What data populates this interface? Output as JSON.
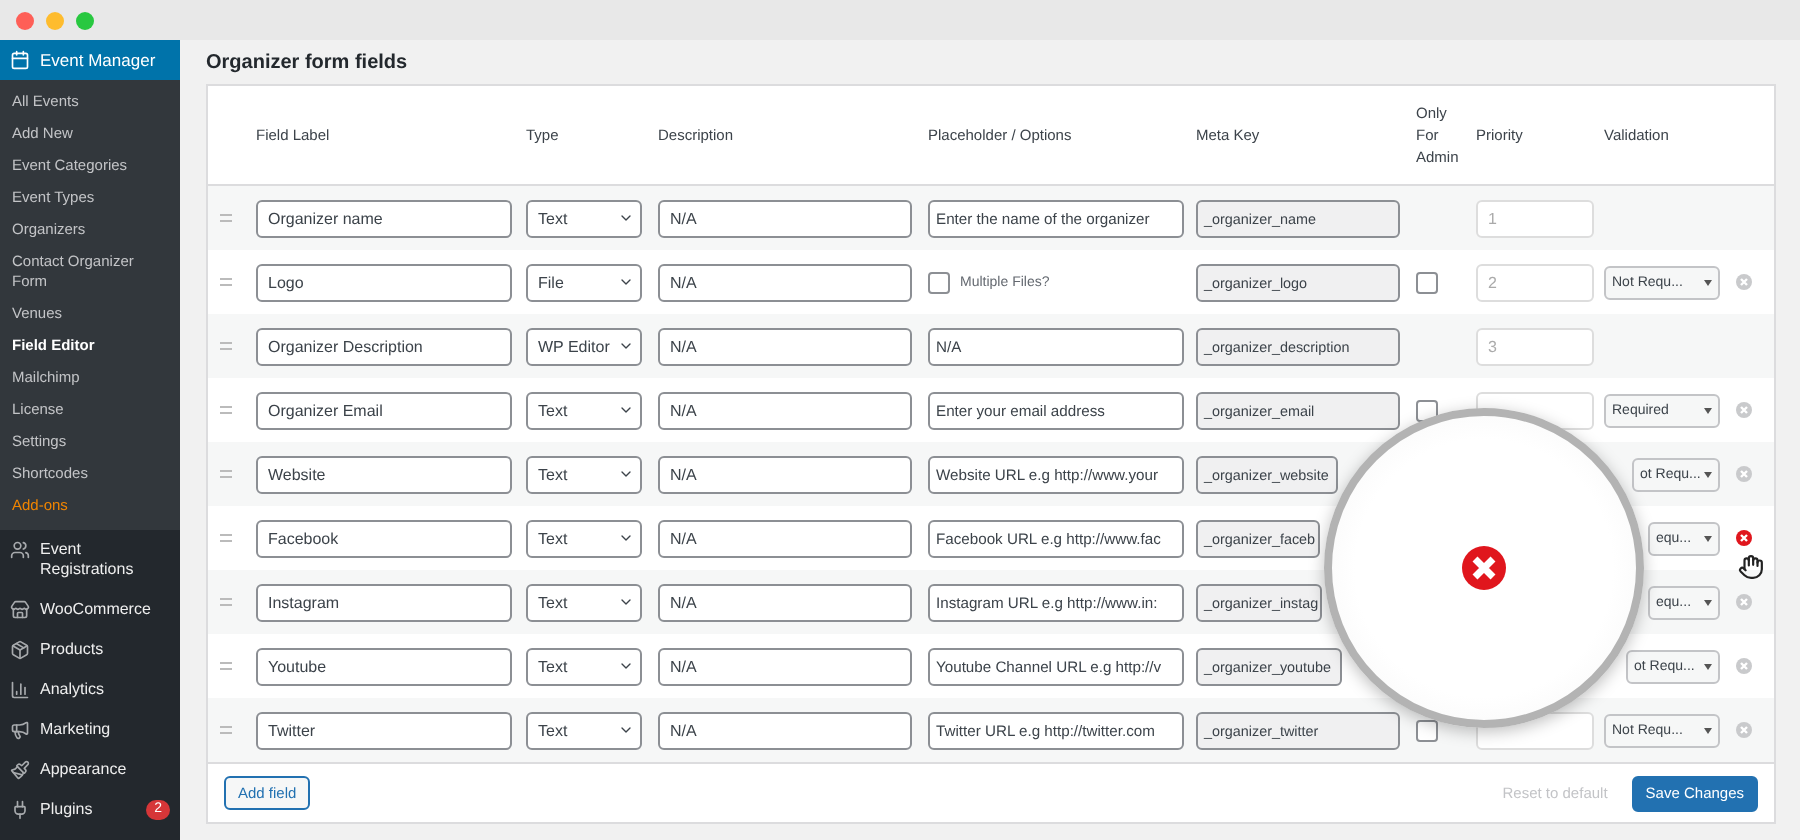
{
  "sidebar": {
    "header": "Event Manager",
    "items": [
      {
        "label": "All Events",
        "selected": false,
        "kind": "link"
      },
      {
        "label": "Add New",
        "selected": false,
        "kind": "link"
      },
      {
        "label": "Event Categories",
        "selected": false,
        "kind": "link"
      },
      {
        "label": "Event Types",
        "selected": false,
        "kind": "link"
      },
      {
        "label": "Organizers",
        "selected": false,
        "kind": "link"
      },
      {
        "label": "Contact Organizer Form",
        "selected": false,
        "kind": "link"
      },
      {
        "label": "Venues",
        "selected": false,
        "kind": "link"
      },
      {
        "label": "Field Editor",
        "selected": true,
        "kind": "link"
      },
      {
        "label": "Mailchimp",
        "selected": false,
        "kind": "link"
      },
      {
        "label": "License",
        "selected": false,
        "kind": "link"
      },
      {
        "label": "Settings",
        "selected": false,
        "kind": "link"
      },
      {
        "label": "Shortcodes",
        "selected": false,
        "kind": "link"
      },
      {
        "label": "Add-ons",
        "selected": false,
        "kind": "promo"
      }
    ],
    "menu": [
      {
        "label": "Event Registrations"
      },
      {
        "label": "WooCommerce"
      },
      {
        "label": "Products"
      },
      {
        "label": "Analytics"
      },
      {
        "label": "Marketing"
      },
      {
        "label": "Appearance"
      },
      {
        "label": "Plugins",
        "badge": "2"
      }
    ]
  },
  "title": "Organizer form fields",
  "columns": [
    "Field Label",
    "Type",
    "Description",
    "Placeholder / Options",
    "Meta Key",
    "Only For Admin",
    "Priority",
    "Validation"
  ],
  "rows": [
    {
      "label": "Organizer name",
      "type": "Text",
      "description": "N/A",
      "options": {
        "kind": "text",
        "value": "Enter the name of the organizer"
      },
      "meta_key": "_organizer_name",
      "priority": "1",
      "covered": false
    },
    {
      "label": "Logo",
      "type": "File",
      "description": "N/A",
      "options": {
        "kind": "checkbox",
        "label": "Multiple Files?",
        "checked": false
      },
      "meta_key": "_organizer_logo",
      "admin": {
        "checked": false
      },
      "priority": "2",
      "validation": "Not Requ...",
      "remove": {
        "active": false
      },
      "covered": false
    },
    {
      "label": "Organizer Description",
      "type": "WP Editor",
      "description": "N/A",
      "options": {
        "kind": "text",
        "value": "N/A"
      },
      "meta_key": "_organizer_description",
      "priority": "3",
      "covered": false
    },
    {
      "label": "Organizer Email",
      "type": "Text",
      "description": "N/A",
      "options": {
        "kind": "text",
        "value": "Enter your email address"
      },
      "meta_key": "_organizer_email",
      "admin": {
        "checked": false
      },
      "validation": "Required",
      "remove": {
        "active": false
      },
      "covered": false
    },
    {
      "label": "Website",
      "type": "Text",
      "description": "N/A",
      "options": {
        "kind": "text",
        "value": "Website URL e.g http://www.your"
      },
      "meta_key": "_organizer_website",
      "validation": "ot Requ...",
      "remove": {
        "active": false
      },
      "covered": true
    },
    {
      "label": "Facebook",
      "type": "Text",
      "description": "N/A",
      "options": {
        "kind": "text",
        "value": "Facebook URL e.g http://www.fac"
      },
      "meta_key": "_organizer_faceb",
      "validation": "equ...",
      "remove": {
        "active": true
      },
      "covered": true
    },
    {
      "label": "Instagram",
      "type": "Text",
      "description": "N/A",
      "options": {
        "kind": "text",
        "value": "Instagram URL e.g http://www.in:"
      },
      "meta_key": "_organizer_instag",
      "validation": "equ...",
      "remove": {
        "active": false
      },
      "covered": true
    },
    {
      "label": "Youtube",
      "type": "Text",
      "description": "N/A",
      "options": {
        "kind": "text",
        "value": "Youtube Channel URL e.g http://v"
      },
      "meta_key": "_organizer_youtube",
      "validation": "ot Requ...",
      "remove": {
        "active": false
      },
      "covered": true
    },
    {
      "label": "Twitter",
      "type": "Text",
      "description": "N/A",
      "options": {
        "kind": "text",
        "value": "Twitter URL e.g http://twitter.com"
      },
      "meta_key": "_organizer_twitter",
      "admin": {
        "checked": false
      },
      "validation": "Not Requ...",
      "remove": {
        "active": false
      },
      "covered": false
    }
  ],
  "footer": {
    "add": "Add field",
    "reset": "Reset to default",
    "save": "Save Changes"
  }
}
